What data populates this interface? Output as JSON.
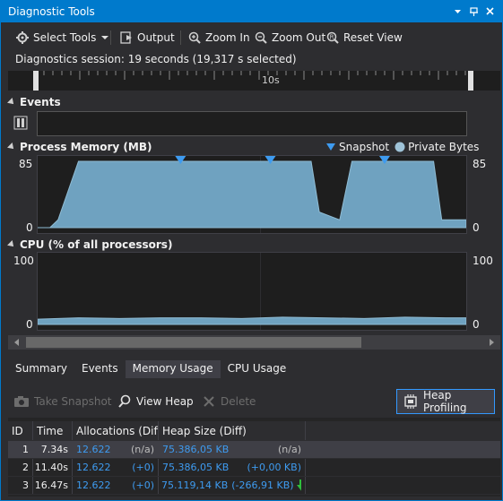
{
  "window": {
    "title": "Diagnostic Tools",
    "accent_color": "#007acc"
  },
  "toolbar": {
    "select_tools": "Select Tools",
    "output": "Output",
    "zoom_in": "Zoom In",
    "zoom_out": "Zoom Out",
    "reset_view": "Reset View"
  },
  "session": {
    "text": "Diagnostics session: 19 seconds (19,317 s selected)"
  },
  "ruler": {
    "tick_label": "10s"
  },
  "events": {
    "title": "Events"
  },
  "memory": {
    "title": "Process Memory (MB)",
    "legend_snapshot": "Snapshot",
    "legend_private_bytes": "Private Bytes",
    "y_max": "85",
    "y_min": "0",
    "series_color": "#6fa2c0",
    "snapshot_color": "#3e9bf0"
  },
  "cpu": {
    "title": "CPU (% of all processors)",
    "y_max": "100",
    "y_min": "0"
  },
  "chart_data": [
    {
      "type": "area",
      "title": "Process Memory (MB)",
      "series": [
        {
          "name": "Private Bytes",
          "x": [
            0,
            0.3,
            0.5,
            1.0,
            6.7,
            6.9,
            7.4,
            7.7,
            8.2,
            9.7,
            9.9,
            10.5
          ],
          "values": [
            0,
            0,
            10,
            85,
            85,
            20,
            10,
            85,
            85,
            85,
            10,
            10
          ]
        }
      ],
      "snapshots_x": [
        3.5,
        5.7,
        8.5
      ],
      "ylim": [
        0,
        85
      ],
      "xlim": [
        0,
        10.5
      ]
    },
    {
      "type": "area",
      "title": "CPU (% of all processors)",
      "series": [
        {
          "name": "",
          "x": [
            0,
            1,
            2,
            3,
            4,
            5,
            6,
            7,
            8,
            9,
            10,
            10.5
          ],
          "values": [
            8,
            10,
            9,
            10,
            10,
            9,
            11,
            10,
            9,
            11,
            10,
            10
          ]
        }
      ],
      "ylim": [
        0,
        100
      ],
      "xlim": [
        0,
        10.5
      ]
    }
  ],
  "tabs": [
    {
      "label": "Summary"
    },
    {
      "label": "Events"
    },
    {
      "label": "Memory Usage"
    },
    {
      "label": "CPU Usage"
    }
  ],
  "panel": {
    "take_snapshot": "Take Snapshot",
    "view_heap": "View Heap",
    "delete": "Delete",
    "heap_profiling": "Heap Profiling"
  },
  "grid": {
    "headers": {
      "id": "ID",
      "time": "Time",
      "alloc": "Allocations (Diff)",
      "heap": "Heap Size (Diff)"
    },
    "rows": [
      {
        "id": "1",
        "time": "7.34s",
        "alloc": "12.622",
        "alloc_diff": "(n/a)",
        "heap": "75.386,05 KB",
        "heap_diff": "(n/a)"
      },
      {
        "id": "2",
        "time": "11.40s",
        "alloc": "12.622",
        "alloc_diff": "(+0)",
        "heap": "75.386,05 KB",
        "heap_diff": "(+0,00 KB)"
      },
      {
        "id": "3",
        "time": "16.47s",
        "alloc": "12.622",
        "alloc_diff": "(+0)",
        "heap": "75.119,14 KB",
        "heap_diff": "(-266,91 KB)"
      }
    ]
  }
}
